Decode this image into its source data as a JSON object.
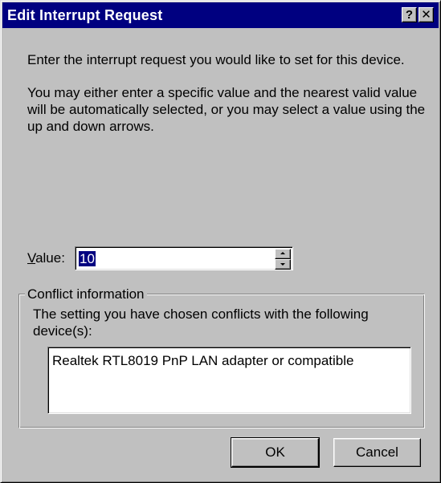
{
  "window": {
    "title": "Edit Interrupt Request",
    "help_glyph": "?",
    "close_glyph": "✕"
  },
  "body": {
    "intro": "Enter the interrupt request you would like to set for this device.",
    "description": "You may either enter a specific value and the nearest valid value will be automatically selected, or you may select a value using the up and down arrows."
  },
  "value_field": {
    "label_underlined": "V",
    "label_rest": "alue:",
    "value": "10"
  },
  "conflict": {
    "legend": "Conflict information",
    "message": "The setting you have chosen conflicts with the following device(s):",
    "devices": [
      "Realtek RTL8019 PnP LAN adapter or compatible"
    ]
  },
  "buttons": {
    "ok": "OK",
    "cancel": "Cancel"
  },
  "colors": {
    "titlebar": "#000080",
    "face": "#c0c0c0",
    "selection": "#000080"
  }
}
